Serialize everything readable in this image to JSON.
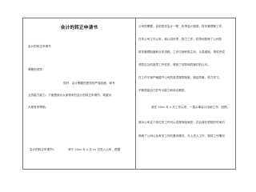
{
  "document": {
    "title": "会计的转正申请书",
    "left": {
      "subtitle": "会计的转正申请书",
      "p1_l1": "尊敬的领导：",
      "p1_l2": "您好，会计需要的是您的严谨态度，和专",
      "p1_l3": "业的能力能力。下面是我为大家带来的会计的转正申请书，希望对",
      "p1_l4": "大家有所帮助。",
      "p2_heading": "会计的转正申请书1",
      "p2_text": "我于 20xx 年 x 月 xx 日进入公司，根据"
    },
    "right": {
      "l1": "公司的需要，目前担任会计一职，负责会计核算、财务管理等工作。",
      "l2": "在本公司工作以来，我认真负责，努力工作，较快地熟悉了公司的",
      "l3": "财务管理制度和业务流程。工作中我积极主动，认真细致，按时完成",
      "l4": "领导交办的各项工作任务，得到了领导和同事们的认可。",
      "l5": "在工作中我严格遵守公司的各项规章制度，团结同事，努力学习，",
      "l6": "不断提高自己的专业能力和综合素质。",
      "p2_l1": "我在 20xx 年 x 月工作以来，一直从事会计出纳工作，回顾。",
      "p2_l2": "我对公司这个岗位的工作可以说是驾轻就熟，并且我在很短的时间内",
      "p2_l3": "熟悉了公司以及有关工作的基本情况，马上进入工作，现将工作情况"
    }
  }
}
